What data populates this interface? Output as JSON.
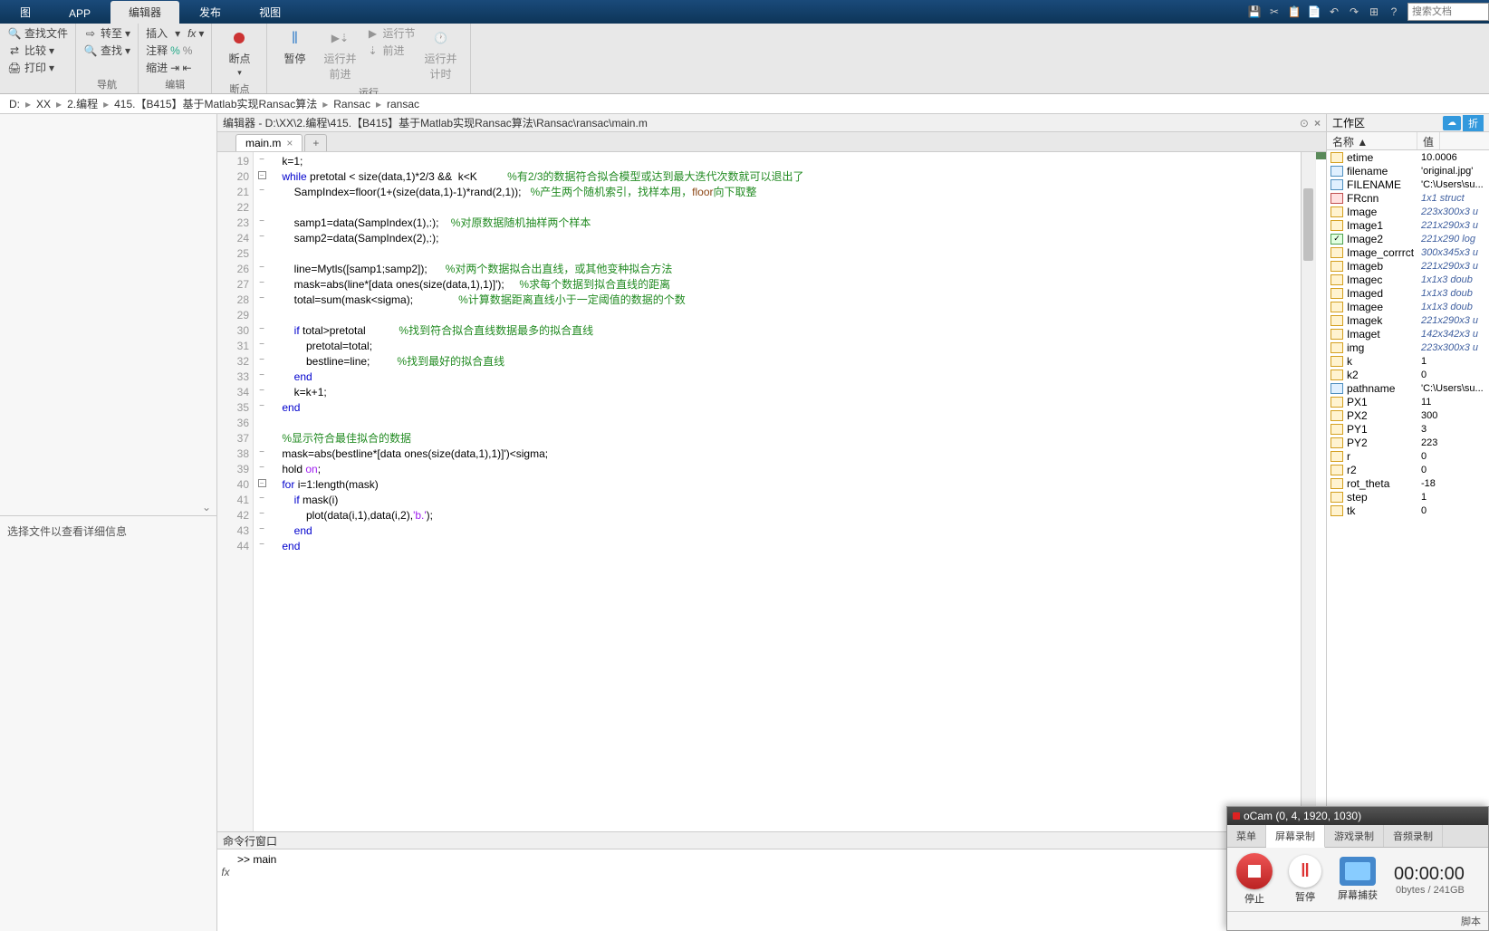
{
  "tabs": {
    "t1": "图",
    "t2": "APP",
    "t3": "编辑器",
    "t4": "发布",
    "t5": "视图"
  },
  "topright": {
    "search_placeholder": "搜索文档"
  },
  "ribbon": {
    "file": {
      "find_files": "查找文件",
      "compare": "比较",
      "print": "打印"
    },
    "nav": {
      "goto": "转至",
      "find": "查找",
      "group": "导航"
    },
    "insert": {
      "insert": "插入",
      "fx": "fx",
      "comment": "注释",
      "indent": "缩进",
      "group": "编辑"
    },
    "bp": {
      "breakpoint": "断点",
      "group": "断点"
    },
    "run": {
      "pause": "暂停",
      "run_advance": "运行并\n前进",
      "run_section": "运行节",
      "advance": "前进",
      "run_time": "运行并\n计时",
      "group": "运行"
    }
  },
  "breadcrumb": {
    "p1": "D:",
    "p2": "XX",
    "p3": "2.编程",
    "p4": "415.【B415】基于Matlab实现Ransac算法",
    "p5": "Ransac",
    "p6": "ransac"
  },
  "editor": {
    "title": "编辑器 - D:\\XX\\2.编程\\415.【B415】基于Matlab实现Ransac算法\\Ransac\\ransac\\main.m",
    "tab": "main.m",
    "lines": [
      {
        "n": 19,
        "dash": true,
        "code": "    k=1;"
      },
      {
        "n": 20,
        "dash": true,
        "fold": "open",
        "code": "    <span class='kw'>while</span> pretotal &lt; size(data,1)*2/3 &amp;&amp;  k&lt;K          <span class='cm'>%有2/3的数据符合拟合模型或达到最大迭代次数就可以退出了</span>"
      },
      {
        "n": 21,
        "dash": true,
        "code": "        SampIndex=floor(1+(size(data,1)-1)*rand(2,1));   <span class='cm'>%产生两个随机索引，找样本用，<span class='fn'>floor</span>向下取整</span>"
      },
      {
        "n": 22,
        "code": ""
      },
      {
        "n": 23,
        "dash": true,
        "code": "        samp1=data(SampIndex(1),:);    <span class='cm'>%对原数据随机抽样两个样本</span>"
      },
      {
        "n": 24,
        "dash": true,
        "code": "        samp2=data(SampIndex(2),:);"
      },
      {
        "n": 25,
        "code": ""
      },
      {
        "n": 26,
        "dash": true,
        "code": "        line=Mytls([samp1;samp2]);      <span class='cm'>%对两个数据拟合出直线，或其他变种拟合方法</span>"
      },
      {
        "n": 27,
        "dash": true,
        "code": "        mask=abs(line*[data ones(size(data,1),1)]');     <span class='cm'>%求每个数据到拟合直线的距离</span>"
      },
      {
        "n": 28,
        "dash": true,
        "code": "        total=sum(mask&lt;sigma);               <span class='cm'>%计算数据距离直线小于一定阈值的数据的个数</span>"
      },
      {
        "n": 29,
        "code": ""
      },
      {
        "n": 30,
        "dash": true,
        "code": "        <span class='kw'>if</span> total&gt;pretotal           <span class='cm'>%找到符合拟合直线数据最多的拟合直线</span>"
      },
      {
        "n": 31,
        "dash": true,
        "code": "            pretotal=total;"
      },
      {
        "n": 32,
        "dash": true,
        "code": "            bestline=line;         <span class='cm'>%找到最好的拟合直线</span>"
      },
      {
        "n": 33,
        "dash": true,
        "code": "        <span class='kw'>end</span>"
      },
      {
        "n": 34,
        "dash": true,
        "code": "        k=k+1;"
      },
      {
        "n": 35,
        "dash": true,
        "code": "    <span class='kw'>end</span>"
      },
      {
        "n": 36,
        "code": ""
      },
      {
        "n": 37,
        "code": "    <span class='cm'>%显示符合最佳拟合的数据</span>"
      },
      {
        "n": 38,
        "dash": true,
        "code": "    mask=abs(bestline*[data ones(size(data,1),1)]')&lt;sigma;"
      },
      {
        "n": 39,
        "dash": true,
        "code": "    hold <span class='str'>on</span>;"
      },
      {
        "n": 40,
        "dash": true,
        "fold": "open",
        "code": "    <span class='kw'>for</span> i=1:length(mask)"
      },
      {
        "n": 41,
        "dash": true,
        "code": "        <span class='kw'>if</span> mask(i)"
      },
      {
        "n": 42,
        "dash": true,
        "code": "            plot(data(i,1),data(i,2),<span class='str'>'b.'</span>);"
      },
      {
        "n": 43,
        "dash": true,
        "code": "        <span class='kw'>end</span>"
      },
      {
        "n": 44,
        "dash": true,
        "code": "    <span class='kw'>end</span>"
      }
    ]
  },
  "cmd": {
    "title": "命令行窗口",
    "prompt": ">> main"
  },
  "workspace": {
    "title": "工作区",
    "expand": "折",
    "col_name": "名称 ▲",
    "col_value": "值",
    "vars": [
      {
        "ico": "num",
        "name": "etime",
        "value": "10.0006"
      },
      {
        "ico": "str",
        "name": "filename",
        "value": "'original.jpg'"
      },
      {
        "ico": "str",
        "name": "FILENAME",
        "value": "'C:\\Users\\su..."
      },
      {
        "ico": "struct",
        "name": "FRcnn",
        "value": "1x1 struct",
        "italic": true
      },
      {
        "ico": "num",
        "name": "Image",
        "value": "223x300x3 u",
        "italic": true
      },
      {
        "ico": "num",
        "name": "Image1",
        "value": "221x290x3 u",
        "italic": true
      },
      {
        "ico": "logical",
        "name": "Image2",
        "value": "221x290 log",
        "italic": true
      },
      {
        "ico": "num",
        "name": "Image_corrrct",
        "value": "300x345x3 u",
        "italic": true
      },
      {
        "ico": "num",
        "name": "Imageb",
        "value": "221x290x3 u",
        "italic": true
      },
      {
        "ico": "num",
        "name": "Imagec",
        "value": "1x1x3 doub",
        "italic": true
      },
      {
        "ico": "num",
        "name": "Imaged",
        "value": "1x1x3 doub",
        "italic": true
      },
      {
        "ico": "num",
        "name": "Imagee",
        "value": "1x1x3 doub",
        "italic": true
      },
      {
        "ico": "num",
        "name": "Imagek",
        "value": "221x290x3 u",
        "italic": true
      },
      {
        "ico": "num",
        "name": "Imaget",
        "value": "142x342x3 u",
        "italic": true
      },
      {
        "ico": "num",
        "name": "img",
        "value": "223x300x3 u",
        "italic": true
      },
      {
        "ico": "num",
        "name": "k",
        "value": "1"
      },
      {
        "ico": "num",
        "name": "k2",
        "value": "0"
      },
      {
        "ico": "str",
        "name": "pathname",
        "value": "'C:\\Users\\su..."
      },
      {
        "ico": "num",
        "name": "PX1",
        "value": "11"
      },
      {
        "ico": "num",
        "name": "PX2",
        "value": "300"
      },
      {
        "ico": "num",
        "name": "PY1",
        "value": "3"
      },
      {
        "ico": "num",
        "name": "PY2",
        "value": "223"
      },
      {
        "ico": "num",
        "name": "r",
        "value": "0"
      },
      {
        "ico": "num",
        "name": "r2",
        "value": "0"
      },
      {
        "ico": "num",
        "name": "rot_theta",
        "value": "-18"
      },
      {
        "ico": "num",
        "name": "step",
        "value": "1"
      },
      {
        "ico": "num",
        "name": "tk",
        "value": "0"
      }
    ]
  },
  "details": {
    "text": "选择文件以查看详细信息"
  },
  "ocam": {
    "title": "oCam (0, 4, 1920, 1030)",
    "tabs": {
      "menu": "菜单",
      "screen": "屏幕录制",
      "game": "游戏录制",
      "audio": "音频录制"
    },
    "stop": "停止",
    "pause": "暂停",
    "capture": "屏幕捕获",
    "time": "00:00:00",
    "size": "0bytes / 241GB",
    "footer": "脚本"
  }
}
